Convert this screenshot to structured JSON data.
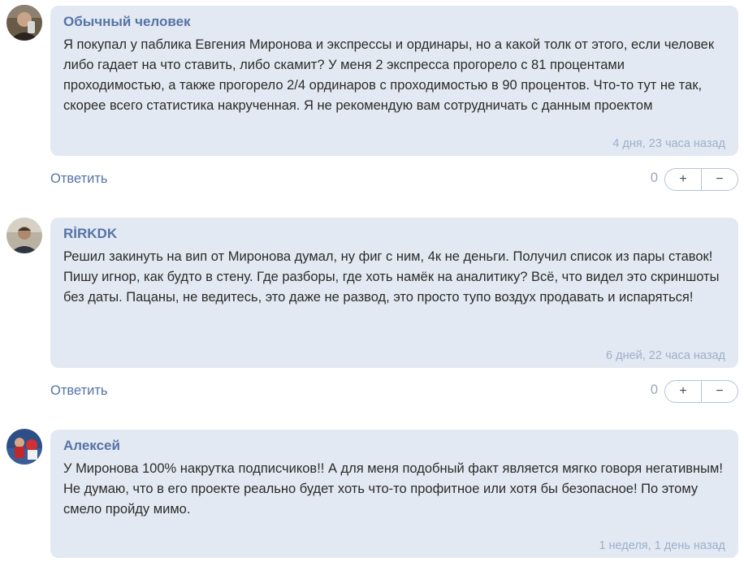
{
  "comments": [
    {
      "author": "Обычный человек",
      "text": "Я покупал у паблика Евгения Миронова и экспрессы и ординары, но а какой толк от этого, если человек либо гадает на что ставить, либо скамит? У меня 2 экспресса прогорело с 81 процентами проходимостью, а также прогорело 2/4 ординаров с проходимостью в 90 процентов. Что-то тут не так, скорее всего статистика накрученная. Я не рекомендую вам сотрудничать с данным проектом",
      "time": "4 дня, 23 часа назад",
      "reply_label": "Ответить",
      "score": "0",
      "upvote_label": "+",
      "downvote_label": "−"
    },
    {
      "author": "RİRKDK",
      "text": "Решил закинуть на вип от Миронова думал, ну фиг с ним, 4к не деньги. Получил список из пары ставок! Пишу игнор, как будто в стену. Где разборы, где хоть намёк на аналитику? Всё, что видел это скриншоты без даты. Пацаны, не ведитесь, это даже не развод, это просто тупо воздух продавать и испаряться!",
      "time": "6 дней, 22 часа назад",
      "reply_label": "Ответить",
      "score": "0",
      "upvote_label": "+",
      "downvote_label": "−"
    },
    {
      "author": "Алексей",
      "text": "У Миронова 100% накрутка подписчиков!! А для меня подобный факт является мягко говоря негативным! Не думаю, что в его проекте реально будет хоть что-то профитное или хотя бы безопасное! По этому смело пройду мимо.",
      "time": "1 неделя, 1 день назад"
    }
  ],
  "colors": {
    "bubble_bg": "#e3e9f2",
    "author": "#5673a6",
    "timestamp": "#9bb0cc",
    "link": "#5673a6"
  }
}
